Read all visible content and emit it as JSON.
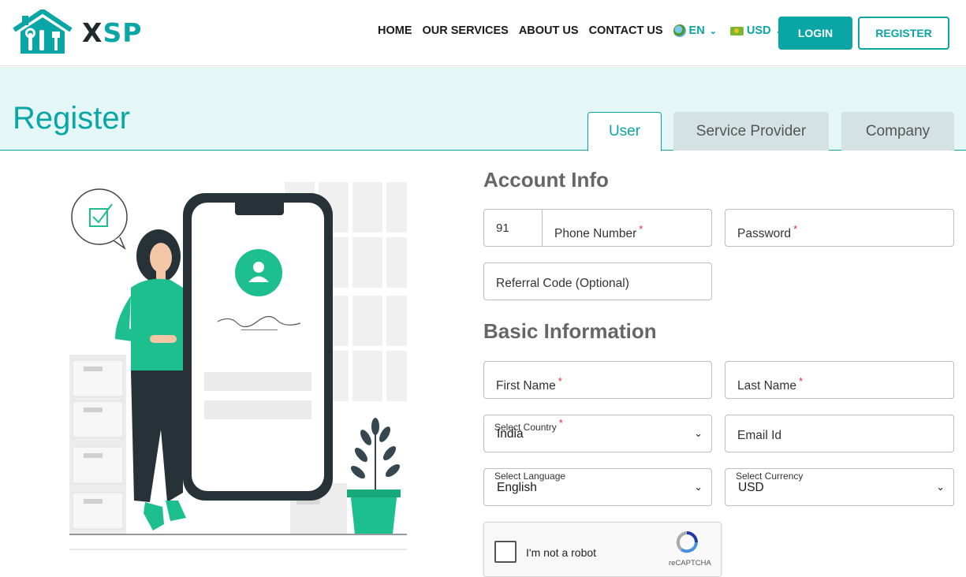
{
  "brand": {
    "x": "X",
    "sp": "SP"
  },
  "nav": {
    "home": "HOME",
    "services": "OUR SERVICES",
    "about": "ABOUT US",
    "contact": "CONTACT US"
  },
  "language": {
    "code": "EN"
  },
  "currency": {
    "code": "USD"
  },
  "auth": {
    "login": "LOGIN",
    "register": "REGISTER"
  },
  "page": {
    "title": "Register"
  },
  "tabs": [
    {
      "label": "User",
      "active": true
    },
    {
      "label": "Service Provider",
      "active": false
    },
    {
      "label": "Company",
      "active": false
    }
  ],
  "account": {
    "title": "Account Info",
    "country_code": "91",
    "phone": "Phone Number",
    "password": "Password",
    "referral": "Referral Code (Optional)"
  },
  "basic": {
    "title": "Basic Information",
    "first_name": "First Name",
    "last_name": "Last Name",
    "country_label": "Select Country",
    "country_value": "India",
    "email": "Email Id",
    "language_label": "Select Language",
    "language_value": "English",
    "currency_label": "Select Currency",
    "currency_value": "USD"
  },
  "captcha": {
    "text": "I'm not a robot",
    "brand": "reCAPTCHA"
  },
  "colors": {
    "accent": "#0aa6a6",
    "banner": "#e5f6f7",
    "required": "#e0303a",
    "illustration_green": "#1dbf8e"
  }
}
